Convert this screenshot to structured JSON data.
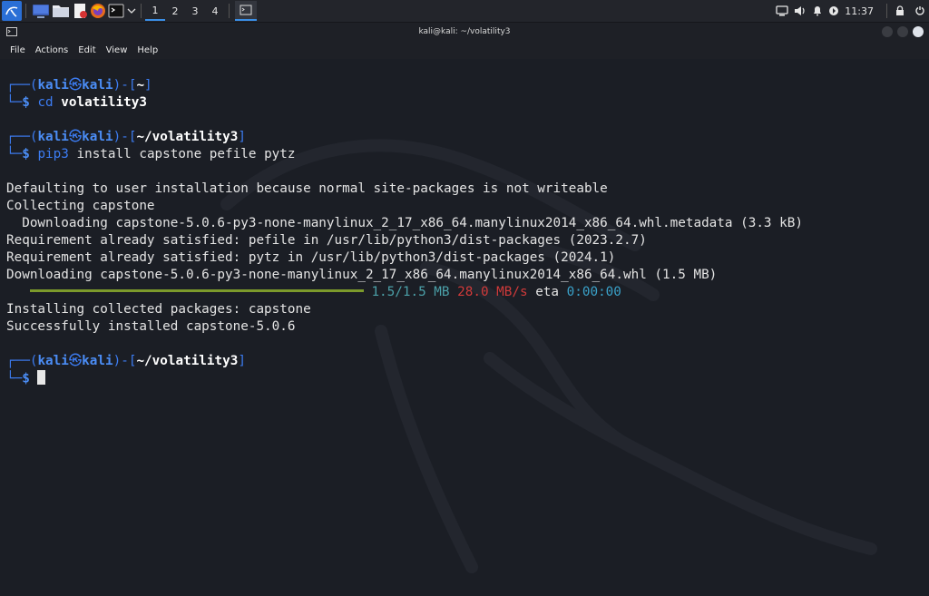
{
  "taskbar": {
    "workspaces": [
      "1",
      "2",
      "3",
      "4"
    ],
    "active_workspace": "1",
    "clock": "11:37"
  },
  "window": {
    "title": "kali@kali: ~/volatility3"
  },
  "menu": {
    "items": [
      "File",
      "Actions",
      "Edit",
      "View",
      "Help"
    ]
  },
  "prompt": {
    "user": "kali",
    "host": "kali",
    "symbol": "$"
  },
  "terminal": {
    "block1_dir": "~",
    "block1_cmd": "cd",
    "block1_arg": "volatility3",
    "block2_dir": "~/volatility3",
    "block2_cmd": "pip3",
    "block2_args": "install capstone pefile pytz",
    "out1": "Defaulting to user installation because normal site-packages is not writeable",
    "out2": "Collecting capstone",
    "out3": "  Downloading capstone-5.0.6-py3-none-manylinux_2_17_x86_64.manylinux2014_x86_64.whl.metadata (3.3 kB)",
    "out4": "Requirement already satisfied: pefile in /usr/lib/python3/dist-packages (2023.2.7)",
    "out5": "Requirement already satisfied: pytz in /usr/lib/python3/dist-packages (2024.1)",
    "out6": "Downloading capstone-5.0.6-py3-none-manylinux_2_17_x86_64.manylinux2014_x86_64.whl (1.5 MB)",
    "progress_size": "1.5/1.5 MB",
    "progress_speed": "28.0 MB/s",
    "progress_eta_label": "eta",
    "progress_eta": "0:00:00",
    "progress_fraction": 1.0,
    "out7": "Installing collected packages: capstone",
    "out8": "Successfully installed capstone-5.0.6",
    "block3_dir": "~/volatility3"
  },
  "colors": {
    "prompt_blue": "#3c7cf2",
    "progress_green": "#7c9a2b",
    "speed_red": "#d03a3a",
    "eta_cyan": "#3aa1c9"
  },
  "icons": [
    "kali-menu-icon",
    "desktop-icon",
    "files-icon",
    "text-editor-icon",
    "firefox-icon",
    "terminal-icon",
    "chevron-down-icon",
    "terminal-window-icon",
    "display-icon",
    "volume-icon",
    "notification-bell-icon",
    "power-manager-icon",
    "lock-icon",
    "logout-icon",
    "minimize-icon",
    "maximize-icon",
    "close-icon",
    "kali-skull-icon"
  ]
}
